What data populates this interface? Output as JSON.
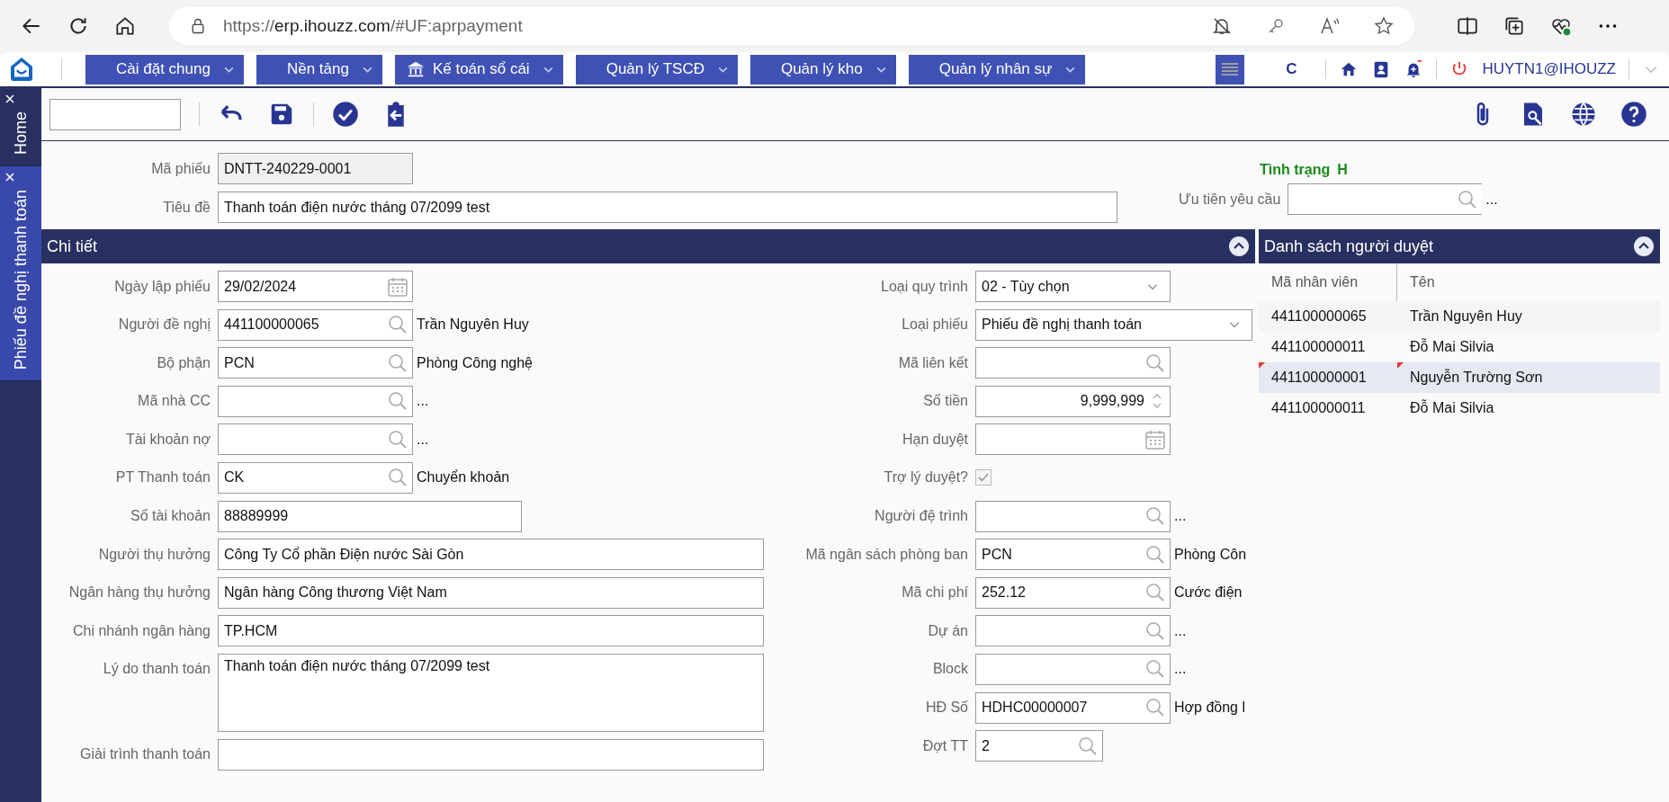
{
  "browser": {
    "url_scheme": "https://",
    "url_host": "erp.ihouzz.com",
    "url_path": "/#UF:aprpayment"
  },
  "nav": {
    "menus": [
      {
        "label": "Cài đặt chung",
        "kind": "plain"
      },
      {
        "label": "Nền tảng",
        "kind": "plain"
      },
      {
        "label": "Kế toán sổ cái",
        "kind": "bank"
      },
      {
        "label": "Quản lý TSCĐ",
        "kind": "plain"
      },
      {
        "label": "Quản lý kho",
        "kind": "plain"
      },
      {
        "label": "Quản lý nhân sự",
        "kind": "plain"
      }
    ],
    "company": "C",
    "user": "HUYTN1@IHOUZZ"
  },
  "side_tabs": [
    {
      "label": "Home",
      "selected": false
    },
    {
      "label": "Phiếu đề nghị thanh toán",
      "selected": true
    }
  ],
  "header": {
    "fields": [
      {
        "label": "Mã phiếu",
        "value": "DNTT-240229-0001",
        "kind": "readonly"
      },
      {
        "label": "Tiêu đề",
        "value": "Thanh toán điện nước tháng 07/2099 test",
        "kind": "title"
      }
    ],
    "status_label": "Tình trạng",
    "status_value": "H",
    "priority": {
      "label": "Ưu tiên yêu cầu",
      "note": "..."
    }
  },
  "detail": {
    "title": "Chi tiết",
    "left": [
      {
        "label": "Ngày lập phiếu",
        "value": "29/02/2024",
        "kind": "date"
      },
      {
        "label": "Người đề nghị",
        "value": "441100000065",
        "kind": "lookup",
        "note": "Trần Nguyên Huy"
      },
      {
        "label": "Bộ phận",
        "value": "PCN",
        "kind": "lookup",
        "note": "Phòng Công nghệ"
      },
      {
        "label": "Mã nhà CC",
        "kind": "lookup",
        "note": "..."
      },
      {
        "label": "Tài khoản nợ",
        "kind": "lookup",
        "note": "..."
      },
      {
        "label": "PT Thanh toán",
        "value": "CK",
        "kind": "lookup",
        "note": "Chuyển khoản"
      },
      {
        "label": "Số tài khoản",
        "value": "88889999",
        "kind": "short-text"
      },
      {
        "label": "Người thụ hưởng",
        "value": "Công Ty Cổ phần Điện nước Sài Gòn",
        "kind": "text"
      },
      {
        "label": "Ngân hàng thụ hưởng",
        "value": "Ngân hàng Công thương Việt Nam",
        "kind": "text"
      },
      {
        "label": "Chi nhánh ngân hàng",
        "value": "TP.HCM",
        "kind": "text"
      },
      {
        "label": "Lý do thanh toán",
        "value": "Thanh toán điện nước tháng 07/2099 test",
        "kind": "textarea"
      },
      {
        "label": "Giải trình thanh toán",
        "kind": "text"
      }
    ],
    "right": [
      {
        "label": "Loại quy trình",
        "value": "02 - Tùy chọn",
        "kind": "select"
      },
      {
        "label": "Loại phiếu",
        "value": "Phiếu đề nghị thanh toán",
        "kind": "wide-select"
      },
      {
        "label": "Mã liên kết",
        "kind": "lookup"
      },
      {
        "label": "Số tiền",
        "value": "9,999,999",
        "kind": "number"
      },
      {
        "label": "Hạn duyệt",
        "kind": "date"
      },
      {
        "label": "Trợ lý duyệt?",
        "kind": "checkbox",
        "checked": true,
        "disabled": true
      },
      {
        "label": "Người đệ trình",
        "kind": "lookup",
        "note": "..."
      },
      {
        "label": "Mã ngân sách phòng ban",
        "value": "PCN",
        "kind": "lookup",
        "note": "Phòng Côn"
      },
      {
        "label": "Mã chi phí",
        "value": "252.12",
        "kind": "lookup",
        "note": "Cước điện"
      },
      {
        "label": "Dự án",
        "kind": "lookup",
        "note": "..."
      },
      {
        "label": "Block",
        "kind": "lookup",
        "note": "..."
      },
      {
        "label": "HĐ Số",
        "value": "HDHC00000007",
        "kind": "lookup",
        "note": "Hợp đồng l"
      },
      {
        "label": "Đợt TT",
        "value": "2",
        "kind": "short-lookup"
      }
    ]
  },
  "approvers": {
    "title": "Danh sách người duyệt",
    "columns": [
      "Mã nhân viên",
      "Tên"
    ],
    "rows": [
      {
        "code": "441100000065",
        "name": "Trần Nguyên Huy",
        "selected": false,
        "flagged": false
      },
      {
        "code": "441100000011",
        "name": "Đỗ Mai Silvia",
        "selected": false,
        "flagged": false
      },
      {
        "code": "441100000001",
        "name": "Nguyễn Trường Sơn",
        "selected": true,
        "flagged": true
      },
      {
        "code": "441100000011",
        "name": "Đỗ Mai Silvia",
        "selected": false,
        "flagged": false
      }
    ]
  }
}
